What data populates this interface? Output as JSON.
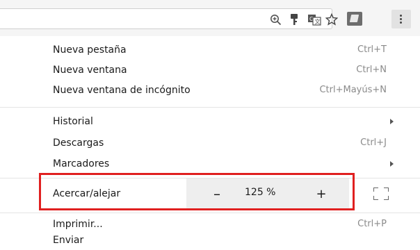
{
  "toolbar": {
    "icons": [
      "zoom-in-icon",
      "key-icon",
      "translate-icon",
      "star-icon",
      "extension-icon",
      "more-vert-icon"
    ]
  },
  "menu": {
    "group1": [
      {
        "label": "Nueva pestaña",
        "shortcut": "Ctrl+T"
      },
      {
        "label": "Nueva ventana",
        "shortcut": "Ctrl+N"
      },
      {
        "label": "Nueva ventana de incógnito",
        "shortcut": "Ctrl+Mayús+N"
      }
    ],
    "group2": [
      {
        "label": "Historial",
        "shortcut": ""
      },
      {
        "label": "Descargas",
        "shortcut": "Ctrl+J"
      },
      {
        "label": "Marcadores",
        "shortcut": ""
      }
    ],
    "zoom": {
      "label": "Acercar/alejar",
      "minus": "–",
      "value": "125 %",
      "plus": "+"
    },
    "group3": [
      {
        "label": "Imprimir...",
        "shortcut": "Ctrl+P"
      },
      {
        "label": "Enviar",
        "shortcut": ""
      }
    ]
  },
  "colors": {
    "highlight": "#e02020",
    "zoom_bg": "#eeeeee"
  }
}
